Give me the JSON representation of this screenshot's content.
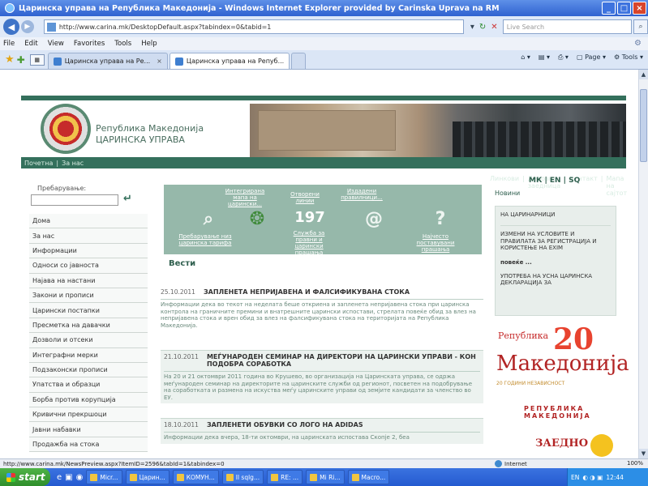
{
  "window": {
    "title": "Царинска управа на Република Македонија - Windows Internet Explorer provided by Carinska Uprava na RM"
  },
  "address_bar": {
    "url": "http://www.carina.mk/DesktopDefault.aspx?tabindex=0&tabid=1",
    "search_placeholder": "Live Search"
  },
  "menu_bar": [
    "File",
    "Edit",
    "View",
    "Favorites",
    "Tools",
    "Help"
  ],
  "tabs": [
    {
      "label": "Царинска управа на Ре..."
    },
    {
      "label": "Царинска управа на Репуб..."
    }
  ],
  "command_bar": [
    "Page",
    "Tools"
  ],
  "site": {
    "org_line1": "Република Македонија",
    "org_line2": "ЦАРИНСКА УПРАВА",
    "topnav_left": [
      "Почетна",
      "|",
      "За нас"
    ],
    "topnav_right": [
      "Линкови",
      "|",
      "Деловна заедница",
      "|",
      "Контакт",
      "|",
      "Мапа на сајтот"
    ],
    "search_label": "Пребарување:",
    "left_menu": [
      "Дома",
      "За нас",
      "Информации",
      "Односи со јавноста",
      "Најава на настани",
      "Закони и прописи",
      "Царински постапки",
      "Пресметка на давачки",
      "Дозволи и отсеки",
      "Интеграфни мерки",
      "Подзаконски прописи",
      "Упатства и образци",
      "Борба против корупција",
      "Кривични прекршоци",
      "Јавни набавки",
      "Продажба на стока"
    ],
    "quick_links_top": [
      "Интегрирана мапа на царински...",
      "Отворени линии",
      "Издадени правилници..."
    ],
    "quick_links_bottom": [
      "Пребарување низ царинска тарифа",
      "Служба за правни и царински прашања",
      "Најчесто поставувани прашања"
    ],
    "quick_icons": [
      "search",
      "coins",
      "197",
      "@",
      "?"
    ],
    "news_heading": "Вести",
    "news": [
      {
        "date": "25.10.2011",
        "title": "ЗАПЛЕНЕТА НЕПРИЈАВЕНА И ФАЛСИФИКУВАНА СТОКА",
        "body": "Информации дека во текот на неделата беше откриена и запленета непријавена стока при царинска контрола на граничните премини и внатрешните царински испостави, стрелата повеќе обид за влез на непријавена стока и врен обид за влез на фалсификувана стока на територијата на Република Македонија."
      },
      {
        "date": "21.10.2011",
        "title": "МЕЃУНАРОДЕН СЕМИНАР НА ДИРЕКТОРИ НА ЦАРИНСКИ УПРАВИ - КОН ПОДОБРА СОРАБОТКА",
        "body": "На 20 и 21 октомври 2011 година во Крушево, во организација на Царинската управа, се одржа меѓународен семинар на директорите на царинските служби од регионот, посветен на подобрување на соработката и размена на искуства меѓу царинските управи од земјите кандидати за членство во ЕУ."
      },
      {
        "date": "18.10.2011",
        "title": "ЗАПЛЕНЕТИ ОБУВКИ СО ЛОГО НА ADIDAS",
        "body": "Информации дека вчера, 18-ти октомври, на царинската испостава Скопје 2, беа"
      }
    ],
    "languages": "МК | EN | SQ",
    "right_heading": "Новини",
    "right_items": [
      {
        "text": "НА ЦАРИНАРНИЦИ",
        "bold": false
      },
      {
        "text": "ИЗМЕНИ НА УСЛОВИТЕ И ПРАВИЛАТА ЗА РЕГИСТРАЦИЈА И КОРИСТЕЊЕ НА EXIM",
        "bold": false
      },
      {
        "text": "повеќе ...",
        "bold": true
      },
      {
        "text": "УПОТРЕБА НА УСНА ЦАРИНСКА ДЕКЛАРАЦИЈА ЗА",
        "bold": false
      }
    ],
    "anniversary_top": "Република",
    "anniversary_num": "20",
    "anniversary_country": "Македонија",
    "anniversary_sub": "20 ГОДИНИ НЕЗАВИСНОСТ",
    "seal_arc": "РЕПУБЛИКА МАКЕДОНИЈА",
    "seal_word": "ЗАЕДНО"
  },
  "status_bar": {
    "url": "http://www.carina.mk/NewsPreview.aspx?ItemID=2596&tabId=1&tabindex=0",
    "zone": "Internet",
    "zoom": "100%"
  },
  "taskbar": {
    "start": "start",
    "tasks": [
      "Micr...",
      "Царин...",
      "КОМУН...",
      "Il sqlg...",
      "RE: ...",
      "Mi Ri...",
      "Macro..."
    ],
    "tray_lang": "EN",
    "clock": "12:44"
  }
}
